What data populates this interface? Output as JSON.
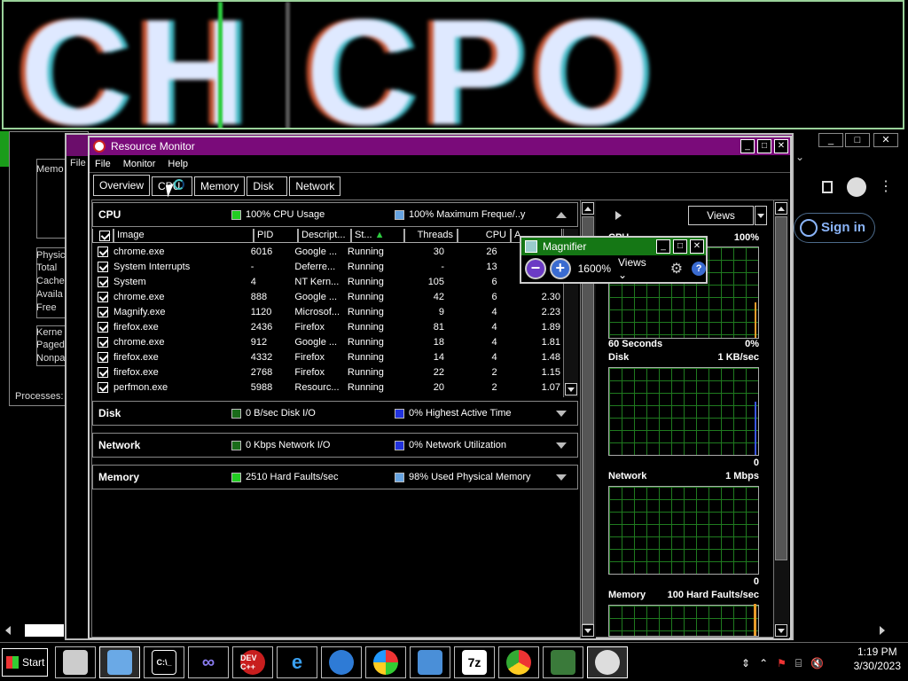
{
  "magnified_text": "CH CPO",
  "background_taskmgr": {
    "labels": [
      "Memo",
      "Physic",
      "Total",
      "Cache",
      "Availa",
      "Free",
      "Kerne",
      "Paged",
      "Nonpa",
      "Processes:"
    ],
    "file_menu": "File"
  },
  "background_browser": {
    "sign_in": "Sign in"
  },
  "resource_monitor": {
    "title": "Resource Monitor",
    "menu": [
      "File",
      "Monitor",
      "Help"
    ],
    "tabs": [
      "Overview",
      "CPU",
      "Memory",
      "Disk",
      "Network"
    ],
    "active_tab": "Overview",
    "cpu": {
      "name": "CPU",
      "indicator1": "100% CPU Usage",
      "indicator1_color": "#22cc22",
      "indicator2": "100% Maximum Freque/..y",
      "indicator2_color": "#66a3e0",
      "columns": [
        "Image",
        "PID",
        "Descript...",
        "St...",
        "Threads",
        "CPU",
        "A..."
      ],
      "rows": [
        {
          "image": "chrome.exe",
          "pid": "6016",
          "desc": "Google ...",
          "status": "Running",
          "threads": "30",
          "cpu": "26",
          "avg": ""
        },
        {
          "image": "System Interrupts",
          "pid": "-",
          "desc": "Deferre...",
          "status": "Running",
          "threads": "-",
          "cpu": "13",
          "avg": ""
        },
        {
          "image": "System",
          "pid": "4",
          "desc": "NT Kern...",
          "status": "Running",
          "threads": "105",
          "cpu": "6",
          "avg": ""
        },
        {
          "image": "chrome.exe",
          "pid": "888",
          "desc": "Google ...",
          "status": "Running",
          "threads": "42",
          "cpu": "6",
          "avg": "2.30"
        },
        {
          "image": "Magnify.exe",
          "pid": "1120",
          "desc": "Microsof...",
          "status": "Running",
          "threads": "9",
          "cpu": "4",
          "avg": "2.23"
        },
        {
          "image": "firefox.exe",
          "pid": "2436",
          "desc": "Firefox",
          "status": "Running",
          "threads": "81",
          "cpu": "4",
          "avg": "1.89"
        },
        {
          "image": "chrome.exe",
          "pid": "912",
          "desc": "Google ...",
          "status": "Running",
          "threads": "18",
          "cpu": "4",
          "avg": "1.81"
        },
        {
          "image": "firefox.exe",
          "pid": "4332",
          "desc": "Firefox",
          "status": "Running",
          "threads": "14",
          "cpu": "4",
          "avg": "1.48"
        },
        {
          "image": "firefox.exe",
          "pid": "2768",
          "desc": "Firefox",
          "status": "Running",
          "threads": "22",
          "cpu": "2",
          "avg": "1.15"
        },
        {
          "image": "perfmon.exe",
          "pid": "5988",
          "desc": "Resourc...",
          "status": "Running",
          "threads": "20",
          "cpu": "2",
          "avg": "1.07"
        }
      ]
    },
    "disk": {
      "name": "Disk",
      "indicator1": "0 B/sec Disk I/O",
      "indicator1_color": "#1a6b1a",
      "indicator2": "0% Highest Active Time",
      "indicator2_color": "#2233dd"
    },
    "network": {
      "name": "Network",
      "indicator1": "0 Kbps Network I/O",
      "indicator1_color": "#1a6b1a",
      "indicator2": "0% Network Utilization",
      "indicator2_color": "#2233dd"
    },
    "memory": {
      "name": "Memory",
      "indicator1": "2510 Hard Faults/sec",
      "indicator1_color": "#22cc22",
      "indicator2": "98% Used Physical Memory",
      "indicator2_color": "#66a3e0"
    },
    "right_pane": {
      "views_label": "Views",
      "cpu_label": "CPU",
      "cpu_max": "100%",
      "cpu_time": "60 Seconds",
      "cpu_min": "0%",
      "disk_label": "Disk",
      "disk_max": "1 KB/sec",
      "disk_min": "0",
      "network_label": "Network",
      "network_max": "1 Mbps",
      "network_min": "0",
      "memory_label": "Memory",
      "memory_max": "100 Hard Faults/sec"
    }
  },
  "magnifier": {
    "title": "Magnifier",
    "zoom": "1600%",
    "views": "Views"
  },
  "taskbar": {
    "start": "Start",
    "buttons": [
      "fax",
      "photo",
      "cmd",
      "visual-studio",
      "DEV C++",
      "IE",
      "browser",
      "windows",
      "remote",
      "7z",
      "chrome",
      "monitor",
      "resource-monitor"
    ],
    "dev_label": "DEV C++",
    "sevenzip_label": "7z",
    "cmd_label": "C:\\_",
    "time": "1:19 PM",
    "date": "3/30/2023"
  }
}
